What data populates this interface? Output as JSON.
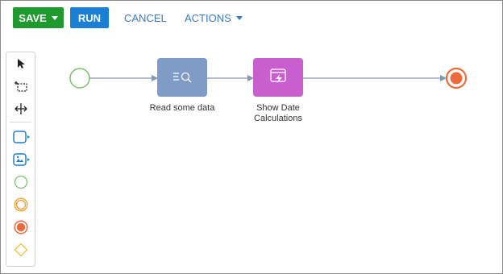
{
  "toolbar": {
    "save_label": "SAVE",
    "run_label": "RUN",
    "cancel_label": "CANCEL",
    "actions_label": "ACTIONS"
  },
  "palette": {
    "tools": [
      {
        "name": "pointer-tool-icon"
      },
      {
        "name": "lasso-tool-icon"
      },
      {
        "name": "space-tool-icon"
      },
      {
        "name": "task-shape-icon"
      },
      {
        "name": "subprocess-shape-icon"
      },
      {
        "name": "start-event-icon"
      },
      {
        "name": "intermediate-event-icon"
      },
      {
        "name": "end-event-icon"
      },
      {
        "name": "gateway-icon"
      }
    ]
  },
  "diagram": {
    "nodes": [
      {
        "id": "start",
        "type": "start-event"
      },
      {
        "id": "read",
        "type": "task",
        "label": "Read some data",
        "color": "#7f9cc7"
      },
      {
        "id": "show",
        "type": "task",
        "label": "Show Date Calculations",
        "color": "#c95fcf"
      },
      {
        "id": "end",
        "type": "end-event"
      }
    ]
  },
  "colors": {
    "save": "#1f9a2f",
    "run": "#1c7fd6",
    "link": "#3a78c4",
    "start_event": "#7ac36a",
    "end_event": "#ef6a3a",
    "gateway": "#f0c14b",
    "flow": "#8497b0"
  }
}
